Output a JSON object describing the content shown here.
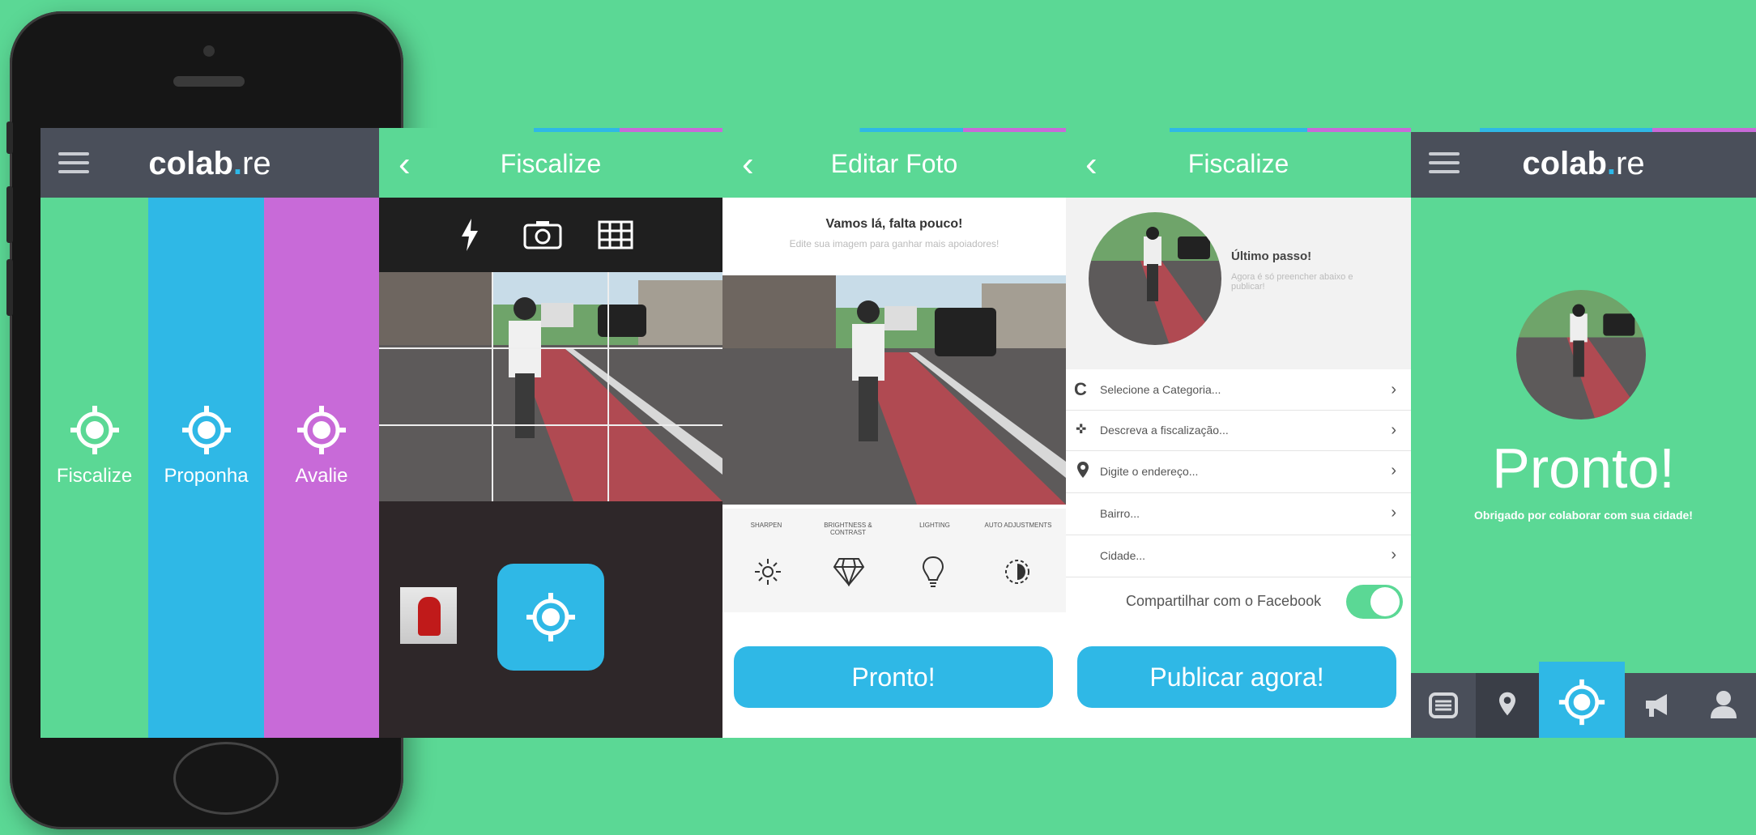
{
  "brand": {
    "logo_main": "colab",
    "logo_dot": ".",
    "logo_suffix": "re"
  },
  "colors": {
    "bg": "#5bd895",
    "blue": "#2fb8e6",
    "purple": "#c86ad8",
    "dark": "#4a4f5a"
  },
  "screen1": {
    "columns": [
      {
        "label": "Fiscalize",
        "icon": "crosshair-icon",
        "color": "#5bd895"
      },
      {
        "label": "Proponha",
        "icon": "crosshair-icon",
        "color": "#2fb8e6"
      },
      {
        "label": "Avalie",
        "icon": "crosshair-icon",
        "color": "#c86ad8"
      }
    ]
  },
  "screen2": {
    "title": "Fiscalize",
    "tools": [
      "flash-icon",
      "camera-switch-icon",
      "grid-icon"
    ]
  },
  "screen3": {
    "title": "Editar Foto",
    "heading": "Vamos lá, falta pouco!",
    "subheading": "Edite sua imagem para ganhar mais apoiadores!",
    "tools": [
      {
        "label": "SHARPEN",
        "icon": "sun-icon"
      },
      {
        "label": "BRIGHTNESS & CONTRAST",
        "icon": "diamond-icon"
      },
      {
        "label": "LIGHTING",
        "icon": "bulb-icon"
      },
      {
        "label": "AUTO ADJUSTMENTS",
        "icon": "auto-adjust-icon"
      }
    ],
    "button": "Pronto!"
  },
  "screen4": {
    "title": "Fiscalize",
    "last_step_title": "Último passo!",
    "last_step_text": "Agora é só preencher abaixo e publicar!",
    "fields": [
      {
        "label": "Selecione a Categoria...",
        "icon": "category-icon"
      },
      {
        "label": "Descreva a fiscalização...",
        "icon": "describe-icon"
      },
      {
        "label": "Digite o endereço...",
        "icon": "pin-icon"
      },
      {
        "label": "Bairro...",
        "icon": ""
      },
      {
        "label": "Cidade...",
        "icon": ""
      }
    ],
    "facebook_label": "Compartilhar com o Facebook",
    "facebook_on": true,
    "button": "Publicar agora!"
  },
  "screen5": {
    "title_main": "Pronto!",
    "subtitle": "Obrigado por colaborar com sua cidade!",
    "tabs": [
      "list-icon",
      "pin-icon",
      "crosshair-icon",
      "megaphone-icon",
      "user-icon"
    ]
  }
}
